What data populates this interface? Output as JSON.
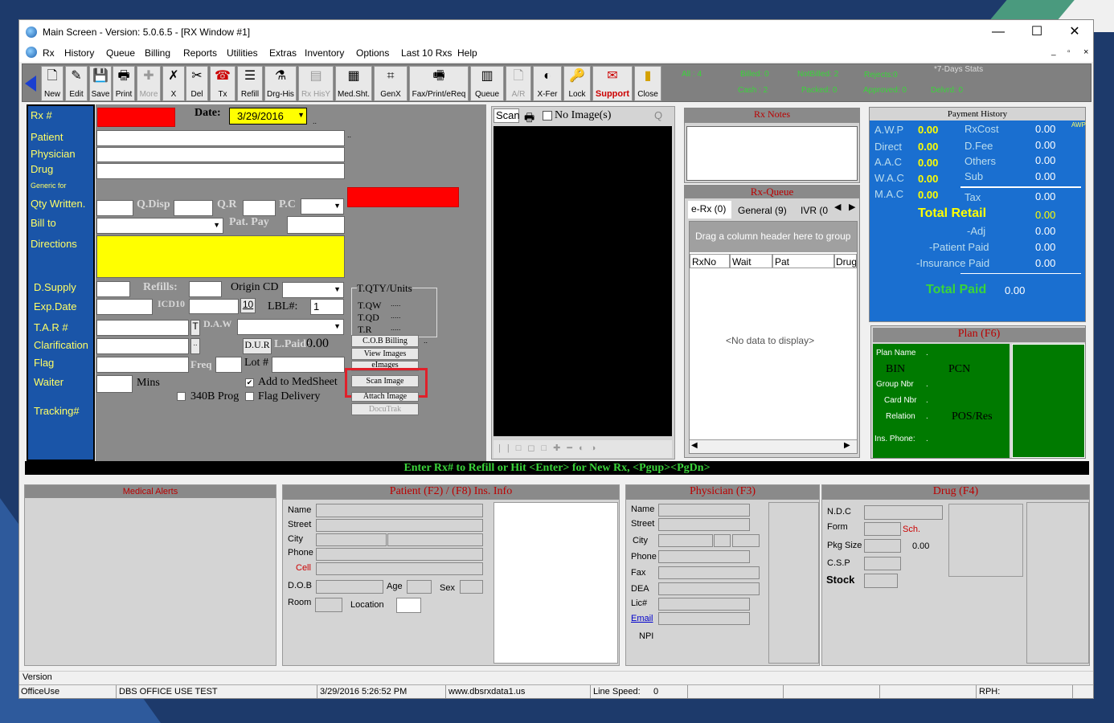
{
  "window": {
    "title": "Main Screen - Version: 5.0.6.5 - [RX Window #1]",
    "min": "—",
    "max": "☐",
    "close": "✕"
  },
  "menu": {
    "items": [
      "Rx",
      "History",
      "Queue",
      "Billing",
      "Reports",
      "Utilities",
      "Extras",
      "Inventory",
      "Options",
      "Last 10 Rxs",
      "Help"
    ],
    "mdi": [
      "_",
      "▫",
      "×"
    ]
  },
  "toolbar": {
    "buttons": [
      {
        "label": "New",
        "icon": "🗋"
      },
      {
        "label": "Edit",
        "icon": "✎"
      },
      {
        "label": "Save",
        "icon": "💾"
      },
      {
        "label": "Print",
        "icon": "🖶"
      },
      {
        "label": "More",
        "icon": "✚"
      },
      {
        "label": "X",
        "icon": "✗"
      },
      {
        "label": "Del",
        "icon": "✂"
      },
      {
        "label": "Tx",
        "icon": "☎"
      },
      {
        "label": "Refill",
        "icon": "☰"
      },
      {
        "label": "Drg-His",
        "icon": "⚗"
      },
      {
        "label": "Rx HisY",
        "icon": "▤"
      },
      {
        "label": "Med.Sht.",
        "icon": "▦"
      },
      {
        "label": "GenX",
        "icon": "⌗"
      },
      {
        "label": "Fax/Print/eReq",
        "icon": "🖷"
      },
      {
        "label": "Queue",
        "icon": "▥"
      },
      {
        "label": "A/R",
        "icon": "🗋"
      },
      {
        "label": "X-Fer",
        "icon": "◐"
      },
      {
        "label": "Lock",
        "icon": "🔑"
      },
      {
        "label": "Support",
        "icon": "✉"
      },
      {
        "label": "Close",
        "icon": "▮"
      }
    ]
  },
  "stats": {
    "all": "All : 4",
    "billed": "Billed: 0",
    "cash": "Cash : 2",
    "notbilled": "NotBilled: 2",
    "packed": "Packed: 0",
    "rejects": "Rejects:0",
    "approved": "Approved: 0",
    "seven": "*7-Days Stats",
    "delvrd": "Delvrd: 0"
  },
  "left": {
    "labels": [
      "Rx #",
      "Patient",
      "Physician",
      "Drug",
      "Generic for",
      "Qty Written.",
      "Bill to",
      "Directions",
      "D.Supply",
      "Exp.Date",
      "T.A.R #",
      "Clarification",
      "Flag",
      "Waiter",
      "Tracking#"
    ]
  },
  "form": {
    "date_label": "Date:",
    "date": "3/29/2016",
    "qdisp": "Q.Disp",
    "qr": "Q.R",
    "pc": "P.C",
    "patpay": "Pat. Pay",
    "refills": "Refills:",
    "origin": "Origin CD",
    "icd10": "ICD10",
    "icd_btn": "10",
    "lbl": "LBL#:",
    "lbl_val": "1",
    "daw": "D.A.W",
    "t_btn": "T",
    "dur": "D.U.R",
    "paid": "L.Paid:",
    "paid_val": "0.00",
    "freq": "Freq",
    "lot": "Lot #",
    "mins": "Mins",
    "addmed": "Add to MedSheet",
    "prog340": "340B Prog",
    "flagdel": "Flag Delivery",
    "tqty": "T.QTY/Units",
    "tqw": "T.QW",
    "tqd": "T.QD",
    "tr": "T.R",
    "dots": ".....",
    "dotsm": "..",
    "buttons": [
      "C.O.B Billing",
      "View Images",
      "eImages",
      "Scan Image",
      "Attach Image",
      "DocuTrak"
    ]
  },
  "scan": {
    "tab": "Scan",
    "noimg": "No Image(s)",
    "q": "Q"
  },
  "rxnotes": {
    "title": "Rx Notes"
  },
  "queue": {
    "title": "Rx-Queue",
    "tabs": [
      "e-Rx (0)",
      "General (9)",
      "IVR (0"
    ],
    "hint": "Drag a column header here to group",
    "cols": [
      "RxNo",
      "Wait",
      "Pat",
      "Drug"
    ],
    "empty": "<No data to display>"
  },
  "payment": {
    "title": "Payment History",
    "awp_tag": "AWP",
    "rows": [
      [
        "A.W.P",
        "0.00",
        "RxCost",
        "0.00"
      ],
      [
        "Direct",
        "0.00",
        "D.Fee",
        "0.00"
      ],
      [
        "A.A.C",
        "0.00",
        "Others",
        "0.00"
      ],
      [
        "W.A.C",
        "0.00",
        "Sub",
        "0.00"
      ],
      [
        "M.A.C",
        "0.00",
        "Tax",
        "0.00"
      ]
    ],
    "totalretail": "Total Retail",
    "tr_val": "0.00",
    "adj": "-Adj",
    "adj_val": "0.00",
    "patpaid": "-Patient Paid",
    "pp_val": "0.00",
    "inspaid": "-Insurance Paid",
    "ip_val": "0.00",
    "totalpaid": "Total Paid",
    "tp_val": "0.00"
  },
  "plan": {
    "title": "Plan (F6)",
    "planname": "Plan Name",
    "bin": "BIN",
    "pcn": "PCN",
    "group": "Group Nbr",
    "card": "Card Nbr",
    "relation": "Relation",
    "posres": "POS/Res",
    "insphone": "Ins. Phone:",
    "dot": "."
  },
  "banner": "Enter Rx# to Refill or Hit <Enter> for New Rx, <Pgup><PgDn>",
  "medalerts": {
    "title": "Medical Alerts"
  },
  "patient": {
    "title": "Patient (F2) / (F8) Ins. Info",
    "labels": [
      "Name",
      "Street",
      "City",
      "Phone",
      "Cell",
      "D.O.B",
      "Room"
    ],
    "age": "Age",
    "sex": "Sex",
    "location": "Location"
  },
  "physician": {
    "title": "Physician (F3)",
    "labels": [
      "Name",
      "Street",
      "City",
      "Phone",
      "Fax",
      "DEA",
      "Lic#",
      "Email",
      "NPI"
    ]
  },
  "drug": {
    "title": "Drug (F4)",
    "labels": [
      "N.D.C",
      "Form",
      "Pkg Size",
      "C.S.P",
      "Stock"
    ],
    "sch": "Sch.",
    "pkgval": "0.00"
  },
  "statusbar": {
    "version": "Version",
    "user": "OfficeUse",
    "store": "DBS OFFICE USE TEST",
    "datetime": "3/29/2016 5:26:52 PM",
    "url": "www.dbsrxdata1.us",
    "linespeed": "Line Speed:",
    "ls_val": "0",
    "rph": "RPH:"
  }
}
